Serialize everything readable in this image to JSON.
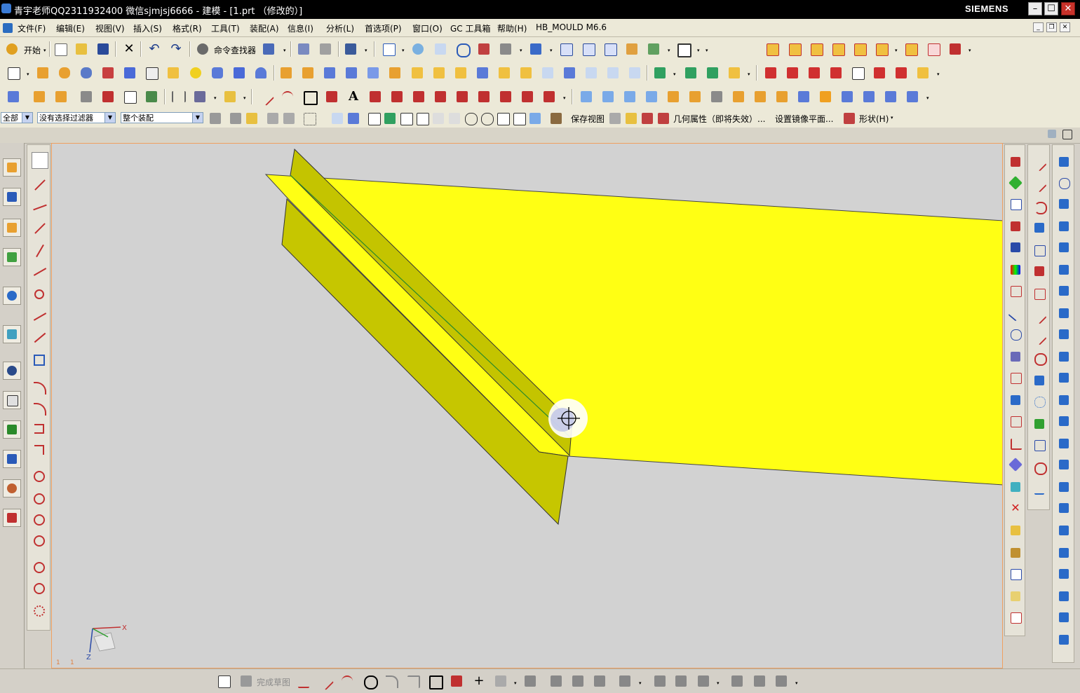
{
  "window": {
    "title": "青宇老师QQ2311932400 微信sjmjsj6666 - 建模 - [1.prt （修改的）]",
    "brand": "SIEMENS",
    "minimize": "–",
    "maximize": "☐",
    "close": "✕"
  },
  "menu": {
    "items": [
      "文件(F)",
      "编辑(E)",
      "视图(V)",
      "插入(S)",
      "格式(R)",
      "工具(T)",
      "装配(A)",
      "信息(I)",
      "分析(L)",
      "首选项(P)",
      "窗口(O)",
      "GC 工具箱",
      "帮助(H)",
      "HB_MOULD M6.6"
    ]
  },
  "standard_toolbar": {
    "start_label": "开始",
    "command_finder_label": "命令查找器"
  },
  "selection_bar": {
    "type_filter": "全部",
    "selection_filter": "没有选择过滤器",
    "scope": "整个装配",
    "save_view_label": "保存视图",
    "geometry_props_label": "几何属性（即将失效）...",
    "mirror_plane_label": "设置镜像平面...",
    "shape_label": "形状(H)"
  },
  "viewport": {
    "surface_color": "#ffff14",
    "flange_color": "#c6c600",
    "background": "#d2d2d2",
    "triad": {
      "x": "X",
      "z": "Z"
    },
    "corner_labels": [
      "1",
      "1"
    ]
  },
  "bottom_toolbar": {
    "finish_sketch_label": "完成草图"
  },
  "icons": {
    "standard": [
      "start-icon",
      "new-file-icon",
      "open-file-icon",
      "save-icon",
      "cut-icon",
      "undo-icon",
      "redo-icon",
      "command-finder-icon",
      "selection-icon",
      "snap-icon",
      "transform-icon",
      "fit-icon",
      "zoom-icon",
      "zoom-window-icon",
      "rotate-icon",
      "pan-icon",
      "render-style-icon",
      "shaded-icon",
      "iso-view-icon",
      "front-view-icon",
      "right-view-icon",
      "layer-icon",
      "edit-object-icon",
      "background-icon"
    ],
    "features": [
      "sketch-icon",
      "extrude-icon",
      "revolve-icon",
      "hole-icon",
      "boss-icon",
      "block-icon",
      "cylinder-icon",
      "cone-icon",
      "sphere-icon",
      "chamfer-icon",
      "blend-icon",
      "shell-icon",
      "trim-body-icon",
      "unite-icon",
      "subtract-icon",
      "intersect-icon",
      "pattern-icon",
      "mirror-icon",
      "offset-icon",
      "thicken-icon",
      "sew-icon",
      "draft-icon"
    ],
    "right1": [
      "view-cube-icon",
      "plane-icon",
      "datum-icon",
      "layer-settings-icon",
      "measure-icon",
      "color-icon",
      "wcs-icon",
      "line-icon",
      "point-icon",
      "hatch-icon",
      "grid-icon",
      "lines-icon",
      "curve-icon",
      "angle-icon",
      "gear-icon",
      "point-set-icon",
      "delete-icon",
      "group-icon",
      "lock-icon",
      "copy-icon",
      "paste-icon",
      "box-icon"
    ],
    "right2": [
      "edit-curve-icon",
      "line-edit-icon",
      "arc-edit-icon",
      "spline-icon",
      "curve-ops-icon",
      "fillet-curve-icon",
      "offset-curve-icon",
      "project-curve-icon",
      "join-curve-icon",
      "trim-curve-icon",
      "circle-edit-icon",
      "bridge-icon",
      "extract-icon",
      "pattern-curve-icon",
      "move-curve-icon",
      "rotate-curve-icon",
      "align-icon"
    ],
    "right3": [
      "mold-wizard-icon",
      "project-init-icon",
      "mold-csys-icon",
      "shrinkage-icon",
      "workpiece-icon",
      "cavity-layout-icon",
      "parting-icon",
      "core-cavity-icon",
      "mold-base-icon",
      "standard-part-icon",
      "ejector-icon",
      "slider-icon",
      "sub-insert-icon",
      "gate-icon",
      "runner-icon",
      "cooling-icon",
      "electrode-icon",
      "trim-icon",
      "pocket-icon",
      "bill-of-material-icon",
      "drawing-icon",
      "bolt-icon",
      "spring-icon",
      "cylinder-part-icon"
    ]
  }
}
